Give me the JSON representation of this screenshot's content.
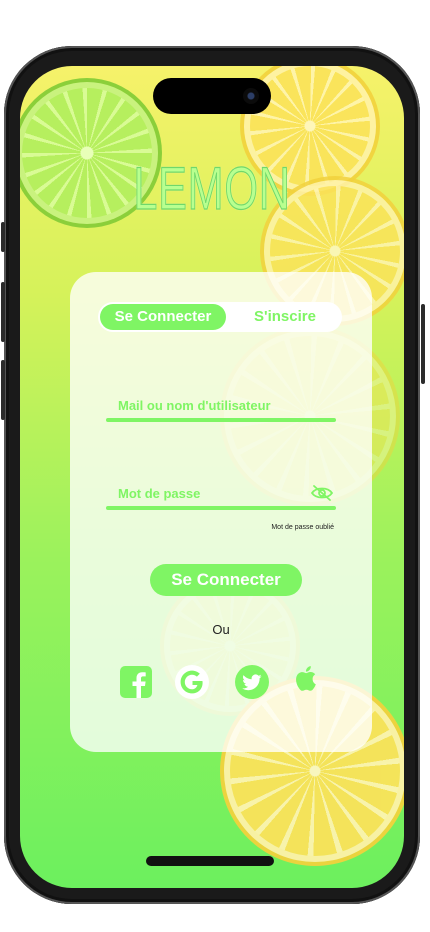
{
  "app": {
    "logo_text": "LEMON"
  },
  "tabs": {
    "login_label": "Se Connecter",
    "signup_label": "S'inscire",
    "active": "login"
  },
  "form": {
    "username_placeholder": "Mail ou nom d'utilisateur",
    "password_placeholder": "Mot de passe",
    "forgot_password": "Mot de passe oublié",
    "submit_label": "Se Connecter",
    "separator": "Ou"
  },
  "social_logins": [
    {
      "name": "facebook",
      "icon": "facebook-icon"
    },
    {
      "name": "google",
      "icon": "google-icon"
    },
    {
      "name": "twitter",
      "icon": "twitter-icon"
    },
    {
      "name": "apple",
      "icon": "apple-icon"
    }
  ],
  "colors": {
    "accent": "#7ff564",
    "logo": "#b8ff8f",
    "background_top": "#f6f26a",
    "background_bottom": "#6cf05e"
  }
}
